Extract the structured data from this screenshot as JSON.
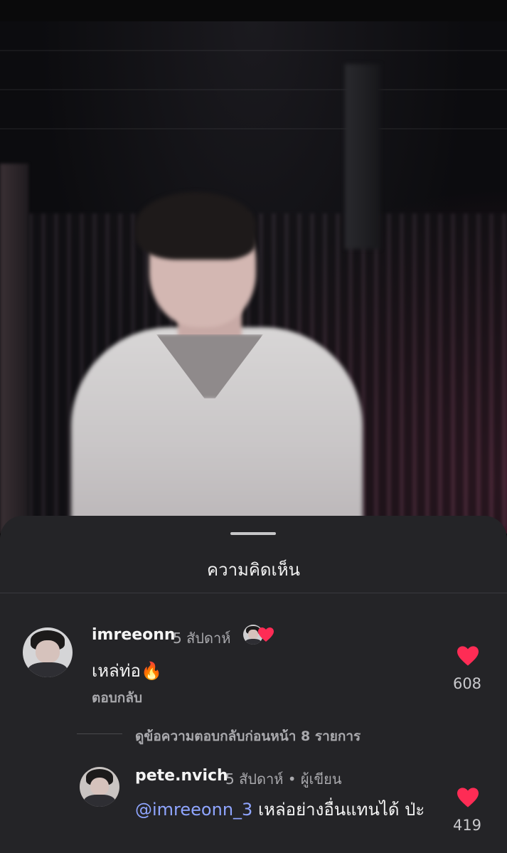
{
  "sheet": {
    "title": "ความคิดเห็น"
  },
  "comments": [
    {
      "username": "imreeonn",
      "time": "5 สัปดาห์",
      "text": "เหล่ท่อ🔥",
      "reply_label": "ตอบกลับ",
      "likes": "608",
      "liked_by_author": true
    },
    {
      "username": "pete.nvich",
      "time": "5 สัปดาห์ • ผู้เขียน",
      "mention": "@imreeonn_3",
      "text": "เหล่อย่างอื่นแทนได้ ป่ะ",
      "likes": "419"
    }
  ],
  "view_previous_replies": "ดูข้อความตอบกลับก่อนหน้า 8 รายการ",
  "colors": {
    "sheet_bg": "#242427",
    "heart": "#fe2c55",
    "mention": "#8fa5ff",
    "muted": "#a9a9ad"
  },
  "icons": [
    "heart-icon",
    "drag-handle"
  ]
}
